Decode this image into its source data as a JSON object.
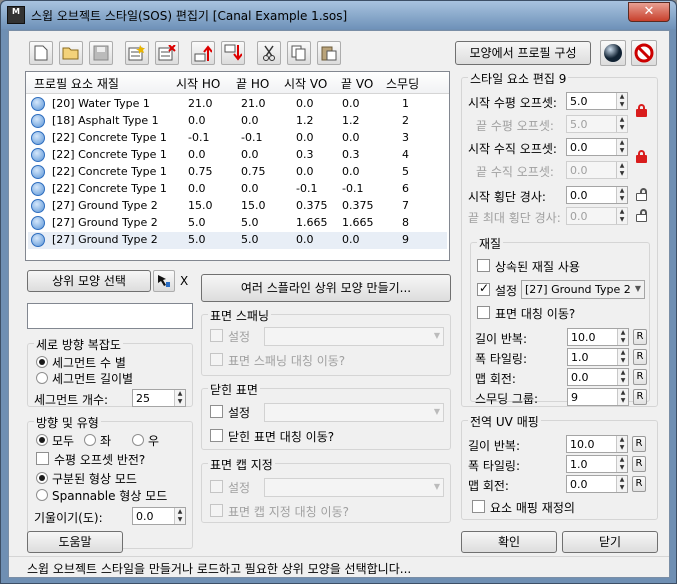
{
  "window": {
    "title": "스윕 오브젝트 스타일(SOS) 편집기 [Canal Example 1.sos]",
    "close": "✕",
    "app_icon": "M"
  },
  "toolbar": {
    "profile_btn": "모양에서 프로필 구성"
  },
  "profile_list": {
    "headers": [
      "프로필 요소 재질",
      "시작 HO",
      "끝 HO",
      "시작 VO",
      "끝 VO",
      "스무딩"
    ],
    "rows": [
      {
        "name": "[20] Water Type 1",
        "sho": "21.0",
        "eho": "21.0",
        "svo": "0.0",
        "evo": "0.0",
        "sm": "1"
      },
      {
        "name": "[18] Asphalt Type 1",
        "sho": "0.0",
        "eho": "0.0",
        "svo": "1.2",
        "evo": "1.2",
        "sm": "2"
      },
      {
        "name": "[22] Concrete Type 1",
        "sho": "-0.1",
        "eho": "-0.1",
        "svo": "0.0",
        "evo": "0.0",
        "sm": "3"
      },
      {
        "name": "[22] Concrete Type 1",
        "sho": "0.0",
        "eho": "0.0",
        "svo": "0.3",
        "evo": "0.3",
        "sm": "4"
      },
      {
        "name": "[22] Concrete Type 1",
        "sho": "0.75",
        "eho": "0.75",
        "svo": "0.0",
        "evo": "0.0",
        "sm": "5"
      },
      {
        "name": "[22] Concrete Type 1",
        "sho": "0.0",
        "eho": "0.0",
        "svo": "-0.1",
        "evo": "-0.1",
        "sm": "6"
      },
      {
        "name": "[27] Ground Type 2",
        "sho": "15.0",
        "eho": "15.0",
        "svo": "0.375",
        "evo": "0.375",
        "sm": "7"
      },
      {
        "name": "[27] Ground Type 2",
        "sho": "5.0",
        "eho": "5.0",
        "svo": "1.665",
        "evo": "1.665",
        "sm": "8"
      },
      {
        "name": "[27] Ground Type 2",
        "sho": "5.0",
        "eho": "5.0",
        "svo": "0.0",
        "evo": "0.0",
        "sm": "9"
      }
    ]
  },
  "parent_shape": {
    "select_btn": "상위 모양 선택",
    "clear": "X",
    "multi_spline_btn": "여러 스플라인 상위 모양 만들기..."
  },
  "vertical_complexity": {
    "title": "세로 방향 복잡도",
    "per_segment": "세그먼트 수 별",
    "per_length": "세그먼트 길이별",
    "segment_count_label": "세그먼트 개수:",
    "segment_count": "25"
  },
  "direction": {
    "title": "방향 및 유형",
    "both": "모두",
    "left": "좌",
    "right": "우",
    "flip_h": "수평 오프셋 반전?",
    "segmented": "구분된 형상 모드",
    "spannable": "Spannable 형상 모드",
    "slope_label": "기울이기(도):",
    "slope": "0.0"
  },
  "surface_spanning": {
    "title": "표면 스패닝",
    "set": "설정",
    "mirror": "표면 스패닝 대칭 이동?"
  },
  "closed_surface": {
    "title": "닫힌 표면",
    "set": "설정",
    "mirror": "닫힌 표면 대칭 이동?"
  },
  "surface_cap": {
    "title": "표면 캡 지정",
    "set": "설정",
    "mirror": "표면 캡 지정 대칭 이동?"
  },
  "style_edit": {
    "title": "스타일 요소 편집 9",
    "start_h": "시작 수평 오프셋:",
    "start_h_val": "5.0",
    "end_h": "끝 수평 오프셋:",
    "end_h_val": "5.0",
    "start_v": "시작 수직 오프셋:",
    "start_v_val": "0.0",
    "end_v": "끝 수직 오프셋:",
    "end_v_val": "0.0",
    "start_slope": "시작 횡단 경사:",
    "start_slope_val": "0.0",
    "end_slope": "끝 최대 횡단 경사:",
    "end_slope_val": "0.0"
  },
  "material": {
    "title": "재질",
    "inherit": "상속된 재질 사용",
    "set": "설정",
    "material_val": "[27] Ground Type 2",
    "mirror": "표면 대칭 이동?",
    "len_rep": "길이 반복:",
    "len_rep_val": "10.0",
    "width_tile": "폭 타일링:",
    "width_tile_val": "1.0",
    "map_rot": "맵 회전:",
    "map_rot_val": "0.0",
    "smooth_grp": "스무딩 그룹:",
    "smooth_grp_val": "9",
    "r": "R"
  },
  "global_uv": {
    "title": "전역 UV 매핑",
    "len_rep": "길이 반복:",
    "len_rep_val": "10.0",
    "width_tile": "폭 타일링:",
    "width_tile_val": "1.0",
    "map_rot": "맵 회전:",
    "map_rot_val": "0.0",
    "redefine": "요소 매핑 재정의",
    "r": "R"
  },
  "footer": {
    "help": "도움말",
    "ok": "확인",
    "close": "닫기"
  },
  "status": "스윕 오브젝트 스타일을 만들거나 로드하고 필요한 상위 모양을 선택합니다..."
}
